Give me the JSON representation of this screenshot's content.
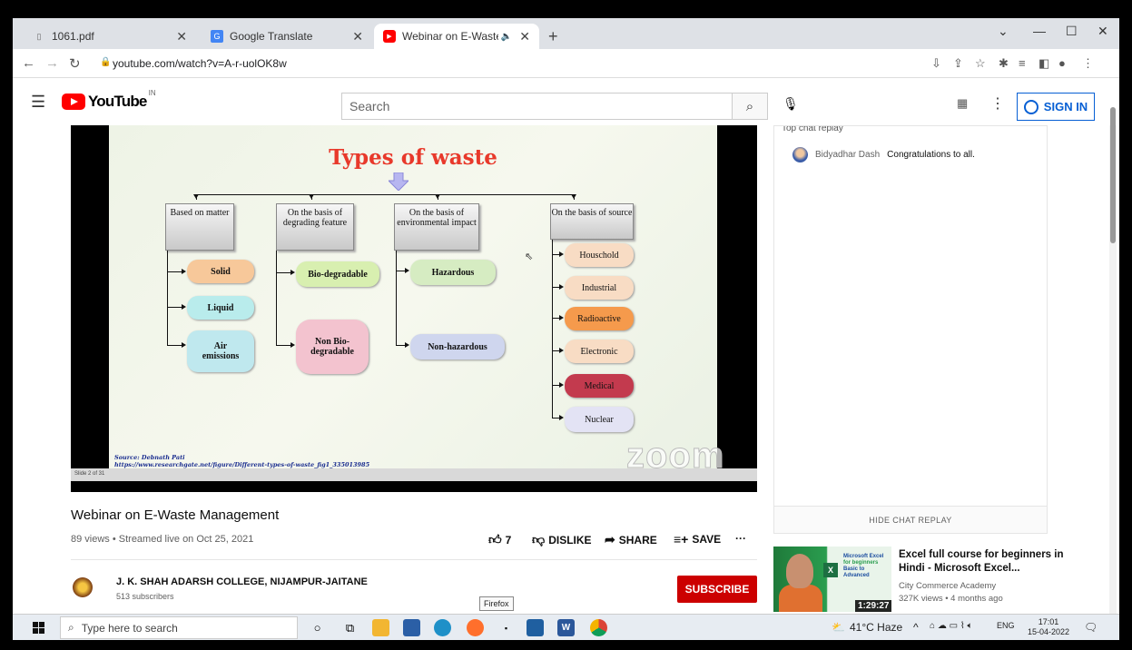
{
  "browser": {
    "tabs": [
      {
        "label": "1061.pdf",
        "active": false
      },
      {
        "label": "Google Translate",
        "active": false
      },
      {
        "label": "Webinar on E-Waste Manage",
        "active": true
      }
    ],
    "url": "youtube.com/watch?v=A-r-uolOK8w"
  },
  "youtube": {
    "logo": "YouTube",
    "country": "IN",
    "search_placeholder": "Search",
    "signin_label": "SIGN IN"
  },
  "slide": {
    "title": "Types of waste",
    "categories": [
      "Based on matter",
      "On the basis of degrading feature",
      "On the basis of environmental impact",
      "On the basis of source"
    ],
    "matter": [
      "Solid",
      "Liquid",
      "Air emissions"
    ],
    "degrading": [
      "Bio-degradable",
      "Non Bio-degradable"
    ],
    "impact": [
      "Hazardous",
      "Non-hazardous"
    ],
    "source": [
      "Houschold",
      "Industrial",
      "Radioactive",
      "Electronic",
      "Medical",
      "Nuclear"
    ],
    "source_credit": "Source: Debnath Pati",
    "source_url": "https://www.researchgate.net/figure/Different-types-of-waste_fig1_335013985",
    "page_indicator": "Slide 2 of 31",
    "zoom_watermark": "zoom",
    "colors": {
      "solid": "#f7c89a",
      "liquid": "#b9ecec",
      "air": "#bfe8ee",
      "bio": "#d8efb0",
      "nonbio": "#f3c3cf",
      "hazardous": "#d6ecc2",
      "nonhazardous": "#cfd6ee",
      "household": "#f8dcc4",
      "industrial": "#f8dcc4",
      "radioactive": "#f59a4c",
      "electronic": "#f8dcc4",
      "medical": "#c33a4e",
      "nuclear": "#e3e3f4"
    }
  },
  "video": {
    "title": "Webinar on E-Waste Management",
    "meta": "89 views • Streamed live on Oct 25, 2021",
    "likes": "7",
    "dislike_label": "DISLIKE",
    "share_label": "SHARE",
    "save_label": "SAVE",
    "channel": "J. K. SHAH ADARSH COLLEGE, NIJAMPUR-JAITANE",
    "subscribers": "513 subscribers",
    "subscribe_label": "SUBSCRIBE",
    "tooltip": "Firefox"
  },
  "chat": {
    "header": "Top chat replay",
    "messages": [
      {
        "author": "Bidyadhar Dash",
        "text": "Congratulations to all."
      }
    ],
    "hide_label": "HIDE CHAT REPLAY"
  },
  "recommendation": {
    "title": "Excel full course for beginners in Hindi - Microsoft Excel...",
    "channel": "City Commerce Academy",
    "views": "327K views • 4 months ago",
    "duration": "1:29:27",
    "thumb_heading": "Microsoft Excel",
    "thumb_sub1": "for beginners",
    "thumb_sub2": "Basic to Advanced"
  },
  "taskbar": {
    "search_placeholder": "Type here to search",
    "weather": "41°C Haze",
    "lang": "ENG",
    "time": "17:01",
    "date": "15-04-2022"
  }
}
